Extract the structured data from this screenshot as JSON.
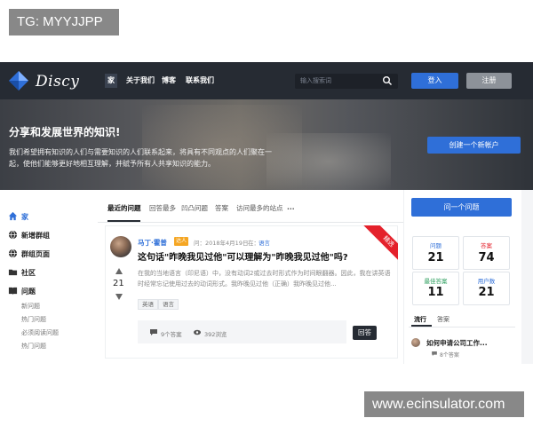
{
  "watermark_top": "TG: MYYJJPP",
  "watermark_bottom": "www.ecinsulator.com",
  "navbar": {
    "brand": "Discy",
    "items": [
      "家",
      "关于我们",
      "博客",
      "联系我们"
    ],
    "search_placeholder": "输入搜索词",
    "login_label": "登入",
    "signup_label": "注册"
  },
  "hero": {
    "title": "分享和发展世界的知识!",
    "description": "我们希望拥有知识的人们与需要知识的人们联系起来，将具有不同观点的人们聚在一起，使他们能够更好地相互理解，并赋予所有人共享知识的能力。",
    "cta_label": "创建一个新帐户"
  },
  "sidebar": {
    "items": [
      {
        "label": "家",
        "icon": "home-icon",
        "active": true
      },
      {
        "label": "新增群组",
        "icon": "globe-icon"
      },
      {
        "label": "群组页面",
        "icon": "globe-icon"
      },
      {
        "label": "社区",
        "icon": "folder-icon"
      },
      {
        "label": "问题",
        "icon": "book-icon"
      }
    ],
    "sub_items": [
      "新问题",
      "热门问题",
      "必须阅读问题",
      "热门问题"
    ]
  },
  "tabs": [
    "最近的问题",
    "回答最多",
    "凹凸问题",
    "答案",
    "访问最多的站点",
    "..."
  ],
  "question": {
    "author": "马丁·霍普",
    "badge": "达人",
    "asked_label": "问：",
    "date": "2018年4月19日",
    "in_label": "在：",
    "category": "语言",
    "ribbon": "精选",
    "title": "这句话\"昨晚我见过他\"可以理解为\"昨晚我见过他\"吗?",
    "excerpt": "在我的当地语言（印尼语）中，没有动词2或过去时形式作为时间眼翻器。因此，我在讲英语时经常忘记使用过去的动词形式。我昨晚见过他（正确）我昨晚见过他...",
    "votes": "21",
    "tags": [
      "英语",
      "语言"
    ],
    "answers_count": "9个答案",
    "views_count": "392浏览",
    "answer_button": "回答"
  },
  "right": {
    "ask_button": "问一个问题",
    "stats": [
      {
        "label": "问题",
        "value": "21",
        "color": "#2f6fd8"
      },
      {
        "label": "答案",
        "value": "74",
        "color": "#e4212b"
      },
      {
        "label": "最佳答案",
        "value": "11",
        "color": "#2a9d5c"
      },
      {
        "label": "用户数",
        "value": "21",
        "color": "#2f6fd8"
      }
    ],
    "tabs": [
      "流行",
      "答案"
    ],
    "popular_question": "如何申请公司工作...",
    "popular_answers": "8个答案"
  }
}
